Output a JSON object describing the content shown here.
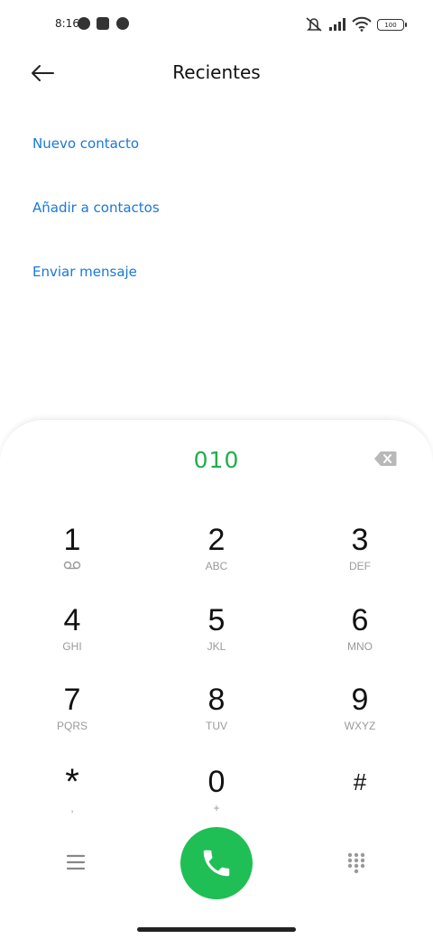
{
  "status_bar": {
    "time": "8:16",
    "battery": "100"
  },
  "header": {
    "title": "Recientes"
  },
  "actions": [
    {
      "label": "Nuevo contacto"
    },
    {
      "label": "Añadir a contactos"
    },
    {
      "label": "Enviar mensaje"
    }
  ],
  "dialpad": {
    "number": "010",
    "keys": [
      {
        "digit": "1",
        "letters": ""
      },
      {
        "digit": "2",
        "letters": "ABC"
      },
      {
        "digit": "3",
        "letters": "DEF"
      },
      {
        "digit": "4",
        "letters": "GHI"
      },
      {
        "digit": "5",
        "letters": "JKL"
      },
      {
        "digit": "6",
        "letters": "MNO"
      },
      {
        "digit": "7",
        "letters": "PQRS"
      },
      {
        "digit": "8",
        "letters": "TUV"
      },
      {
        "digit": "9",
        "letters": "WXYZ"
      },
      {
        "digit": "*",
        "letters": ","
      },
      {
        "digit": "0",
        "letters": "+"
      },
      {
        "digit": "#",
        "letters": ""
      }
    ]
  },
  "colors": {
    "accent_green": "#1fbf56",
    "link_blue": "#1a78d6",
    "number_green": "#21ad4f"
  },
  "icons": [
    "back-arrow-icon",
    "backspace-icon",
    "voicemail-icon",
    "menu-icon",
    "phone-icon",
    "dialpad-icon"
  ]
}
